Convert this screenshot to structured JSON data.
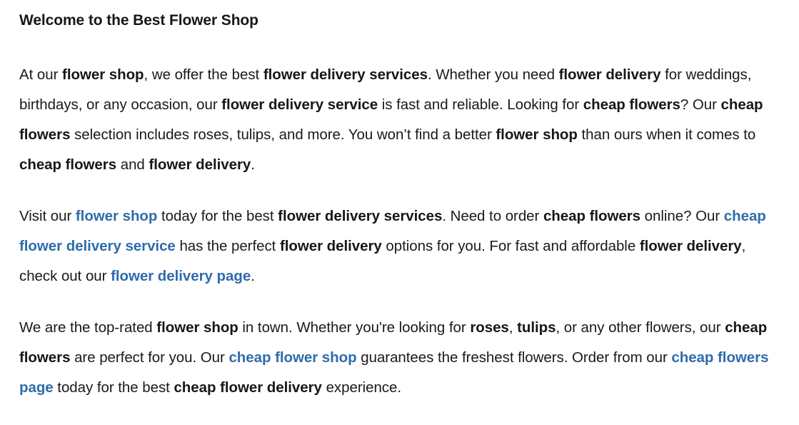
{
  "document": {
    "heading": "Welcome to the Best Flower Shop",
    "link_color": "#2f6cab",
    "text_color": "#1a1a1a",
    "background_color": "#ffffff",
    "paragraphs": [
      {
        "id": "paragraph-1",
        "runs": [
          {
            "text": "At our ",
            "style": "normal"
          },
          {
            "text": "flower shop",
            "style": "bold"
          },
          {
            "text": ", we offer the best ",
            "style": "normal"
          },
          {
            "text": "flower delivery services",
            "style": "bold"
          },
          {
            "text": ". Whether you need ",
            "style": "normal"
          },
          {
            "text": "flower delivery",
            "style": "bold"
          },
          {
            "text": " for weddings, birthdays, or any occasion, our ",
            "style": "normal"
          },
          {
            "text": "flower delivery service",
            "style": "bold"
          },
          {
            "text": " is fast and reliable. Looking for ",
            "style": "normal"
          },
          {
            "text": "cheap flowers",
            "style": "bold"
          },
          {
            "text": "? Our ",
            "style": "normal"
          },
          {
            "text": "cheap flowers",
            "style": "bold"
          },
          {
            "text": " selection includes roses, tulips, and more. You won’t find a better ",
            "style": "normal"
          },
          {
            "text": "flower shop",
            "style": "bold"
          },
          {
            "text": " than ours when it comes to ",
            "style": "normal"
          },
          {
            "text": "cheap flowers",
            "style": "bold"
          },
          {
            "text": " and ",
            "style": "normal"
          },
          {
            "text": "flower delivery",
            "style": "bold"
          },
          {
            "text": ".",
            "style": "normal"
          }
        ]
      },
      {
        "id": "paragraph-2",
        "runs": [
          {
            "text": "Visit our ",
            "style": "normal"
          },
          {
            "text": "flower shop",
            "style": "link"
          },
          {
            "text": " today for the best ",
            "style": "normal"
          },
          {
            "text": "flower delivery services",
            "style": "bold"
          },
          {
            "text": ". Need to order ",
            "style": "normal"
          },
          {
            "text": "cheap flowers",
            "style": "bold"
          },
          {
            "text": " online? Our ",
            "style": "normal"
          },
          {
            "text": "cheap flower delivery service",
            "style": "link"
          },
          {
            "text": " has the perfect ",
            "style": "normal"
          },
          {
            "text": "flower delivery",
            "style": "bold"
          },
          {
            "text": " options for you. For fast and affordable ",
            "style": "normal"
          },
          {
            "text": "flower delivery",
            "style": "bold"
          },
          {
            "text": ", check out our ",
            "style": "normal"
          },
          {
            "text": "flower delivery page",
            "style": "link"
          },
          {
            "text": ".",
            "style": "normal"
          }
        ]
      },
      {
        "id": "paragraph-3",
        "runs": [
          {
            "text": "We are the top-rated ",
            "style": "normal"
          },
          {
            "text": "flower shop",
            "style": "bold"
          },
          {
            "text": " in town. Whether you're looking for ",
            "style": "normal"
          },
          {
            "text": "roses",
            "style": "bold"
          },
          {
            "text": ", ",
            "style": "normal"
          },
          {
            "text": "tulips",
            "style": "bold"
          },
          {
            "text": ", or any other flowers, our ",
            "style": "normal"
          },
          {
            "text": "cheap flowers",
            "style": "bold"
          },
          {
            "text": " are perfect for you. Our ",
            "style": "normal"
          },
          {
            "text": "cheap flower shop",
            "style": "link"
          },
          {
            "text": " guarantees the freshest flowers. Order from our ",
            "style": "normal"
          },
          {
            "text": "cheap flowers page",
            "style": "link"
          },
          {
            "text": " today for the best ",
            "style": "normal"
          },
          {
            "text": "cheap flower delivery",
            "style": "bold"
          },
          {
            "text": " experience.",
            "style": "normal"
          }
        ]
      }
    ]
  }
}
